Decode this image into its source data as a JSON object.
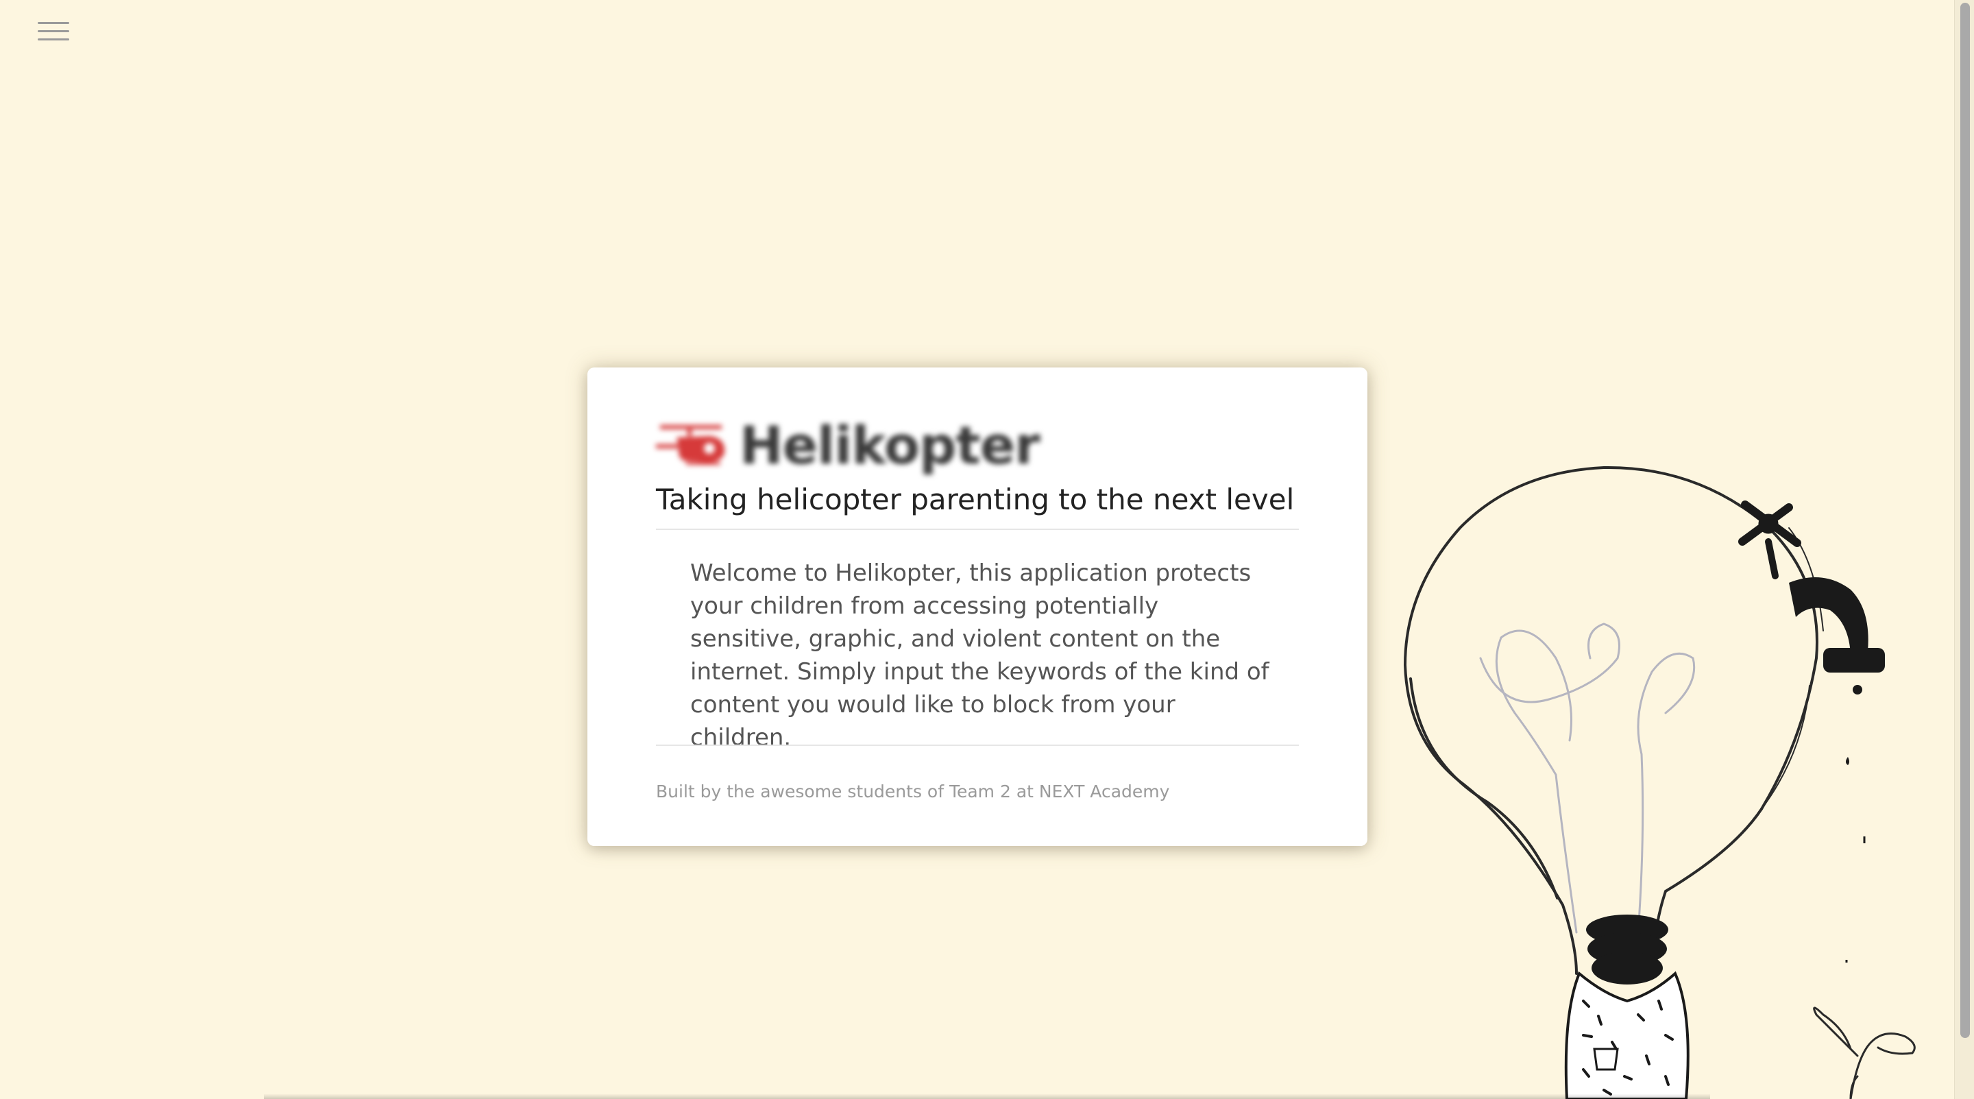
{
  "header": {
    "menu_icon": "hamburger-menu-icon"
  },
  "card": {
    "logo": {
      "text": "Helikopter",
      "icon": "helicopter-logo-icon",
      "color": "#d63a3a"
    },
    "tagline": "Taking helicopter parenting to the next level",
    "description": "Welcome to Helikopter, this application protects your children from accessing potentially sensitive, graphic, and violent content on the internet. Simply input the keywords of the kind of content you would like to block from your children.",
    "footer": "Built by the awesome students of Team 2 at NEXT Academy"
  },
  "illustration": {
    "icon": "lightbulb-helicopter-illustration"
  },
  "colors": {
    "background": "#fdf6e0",
    "card": "#ffffff",
    "text_dark": "#222222",
    "text_body": "#555555",
    "text_muted": "#9a9a9a",
    "accent": "#d63a3a"
  }
}
